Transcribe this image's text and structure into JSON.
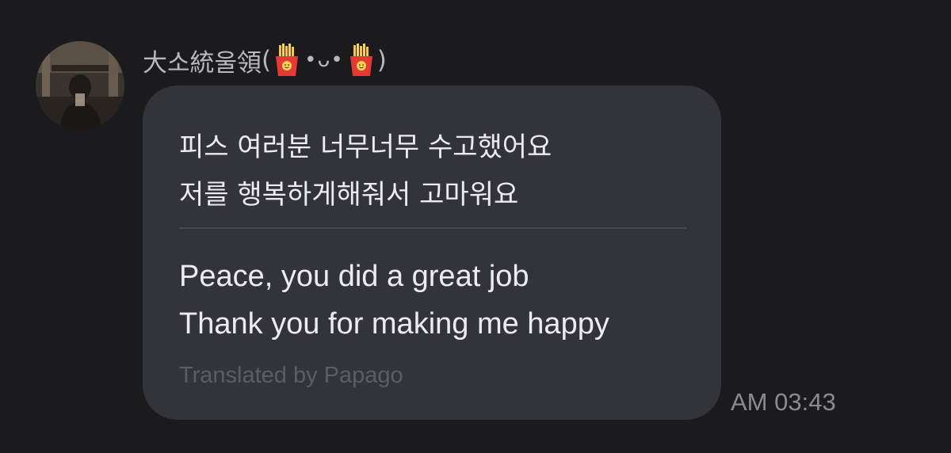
{
  "sender": {
    "name": "大소統울領",
    "open_paren": "(",
    "left_icon": "french-fries-icon",
    "face": "•ᴗ•",
    "right_icon": "french-fries-icon",
    "close_paren": ")"
  },
  "message": {
    "original_lines": [
      "피스 여러분 너무너무 수고했어요",
      "저를 행복하게해줘서 고마워요"
    ],
    "translated_lines": [
      "Peace, you did a great job",
      "Thank you for making me happy"
    ],
    "translator_credit": "Translated by Papago",
    "time": "AM 03:43"
  },
  "colors": {
    "background": "#1b1b1e",
    "bubble": "#33343a",
    "text_primary": "#ececf0",
    "text_muted": "#5c5d64",
    "timestamp": "#8a8b91"
  }
}
